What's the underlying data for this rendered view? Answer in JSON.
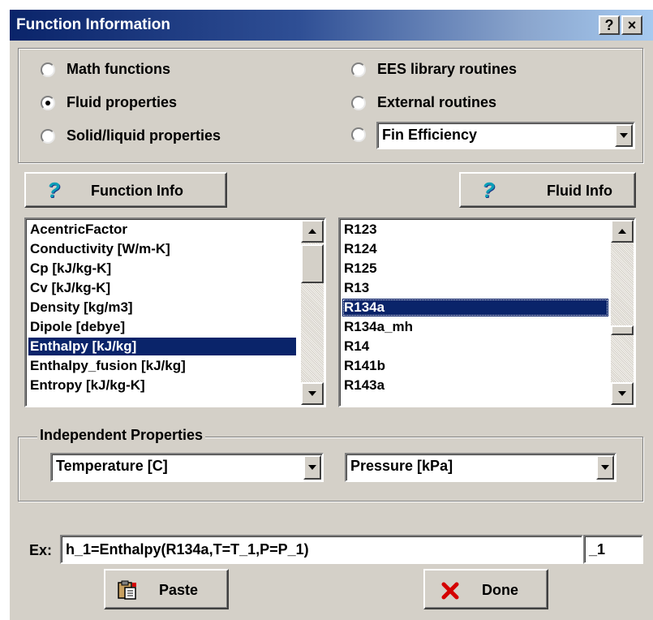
{
  "window": {
    "title": "Function Information",
    "help_button": "?",
    "close_button": "×"
  },
  "function_type": {
    "options": [
      {
        "label": "Math functions",
        "selected": false
      },
      {
        "label": "Fluid properties",
        "selected": true
      },
      {
        "label": "Solid/liquid properties",
        "selected": false
      },
      {
        "label": "EES library routines",
        "selected": false
      },
      {
        "label": "External routines",
        "selected": false
      }
    ],
    "routine_combo_value": "Fin Efficiency"
  },
  "buttons": {
    "function_info": "Function Info",
    "fluid_info": "Fluid Info",
    "paste": "Paste",
    "done": "Done"
  },
  "function_list": {
    "items": [
      "AcentricFactor",
      "Conductivity [W/m-K]",
      "Cp [kJ/kg-K]",
      "Cv [kJ/kg-K]",
      "Density [kg/m3]",
      "Dipole [debye]",
      "Enthalpy [kJ/kg]",
      "Enthalpy_fusion [kJ/kg]",
      "Entropy [kJ/kg-K]"
    ],
    "selected": "Enthalpy [kJ/kg]"
  },
  "fluid_list": {
    "items": [
      "R123",
      "R124",
      "R125",
      "R13",
      "R134a",
      "R134a_mh",
      "R14",
      "R141b",
      "R143a"
    ],
    "selected": "R134a"
  },
  "independent_properties": {
    "group_label": "Independent Properties",
    "property_1": "Temperature [C]",
    "property_2": "Pressure [kPa]"
  },
  "example": {
    "label": "Ex:",
    "equation": "h_1=Enthalpy(R134a,T=T_1,P=P_1)",
    "suffix": "_1"
  },
  "colors": {
    "selection": "#0a246a",
    "dialog_face": "#d4d0c8",
    "done_icon": "#d40000"
  },
  "icons": {
    "help": "question-mark-icon",
    "paste": "clipboard-paste-icon",
    "done": "red-x-icon"
  }
}
